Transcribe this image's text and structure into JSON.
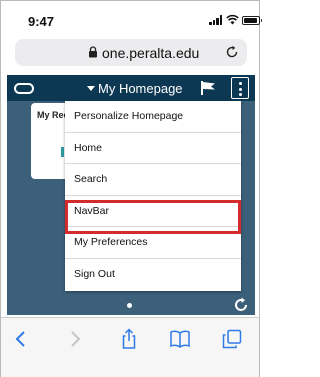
{
  "status_bar": {
    "time": "9:47"
  },
  "browser": {
    "url": "one.peralta.edu"
  },
  "header": {
    "title": "My Homepage"
  },
  "tile": {
    "title": "My Rec"
  },
  "menu": {
    "items": [
      {
        "label": "Personalize Homepage"
      },
      {
        "label": "Home"
      },
      {
        "label": "Search"
      },
      {
        "label": "NavBar"
      },
      {
        "label": "My Preferences"
      },
      {
        "label": "Sign Out"
      }
    ],
    "highlighted": "NavBar",
    "highlight_color": "#d42c2c"
  },
  "colors": {
    "header_bar": "#0d3853",
    "page_background": "#3c607a",
    "ios_blue": "#2f7ae5"
  },
  "toolbar": {
    "icons": [
      "back-icon",
      "forward-icon",
      "share-icon",
      "bookmarks-icon",
      "tabs-icon"
    ]
  }
}
